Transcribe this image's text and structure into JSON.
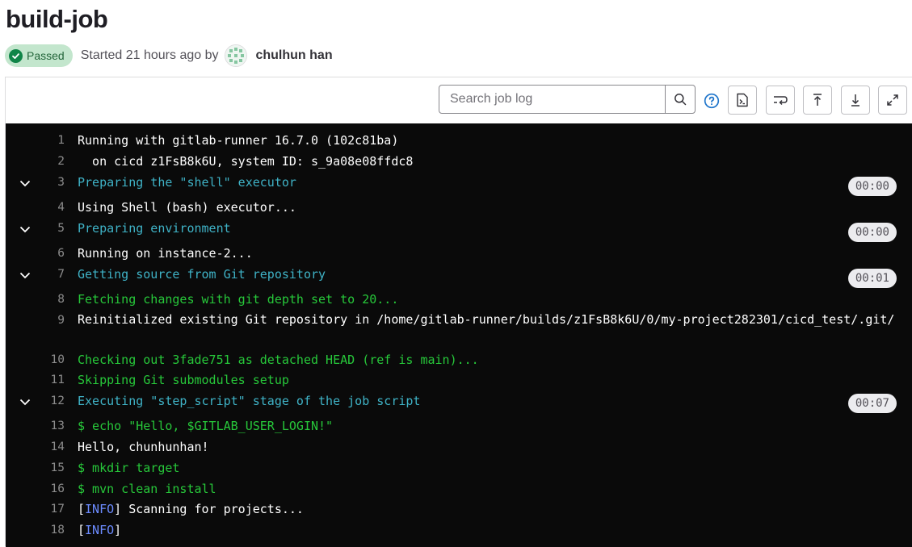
{
  "job": {
    "title": "build-job",
    "status": "Passed",
    "started": "Started 21 hours ago by",
    "user": "chulhun han"
  },
  "toolbar": {
    "search_placeholder": "Search job log"
  },
  "log": {
    "l1": {
      "n": "1",
      "t": "Running with gitlab-runner 16.7.0 (102c81ba)"
    },
    "l2": {
      "n": "2",
      "t": "  on cicd z1FsB8k6U, system ID: s_9a08e08ffdc8"
    },
    "l3": {
      "n": "3",
      "t": "Preparing the \"shell\" executor",
      "d": "00:00"
    },
    "l4": {
      "n": "4",
      "t": "Using Shell (bash) executor..."
    },
    "l5": {
      "n": "5",
      "t": "Preparing environment",
      "d": "00:00"
    },
    "l6": {
      "n": "6",
      "t": "Running on instance-2..."
    },
    "l7": {
      "n": "7",
      "t": "Getting source from Git repository",
      "d": "00:01"
    },
    "l8": {
      "n": "8",
      "t": "Fetching changes with git depth set to 20..."
    },
    "l9": {
      "n": "9",
      "t": "Reinitialized existing Git repository in /home/gitlab-runner/builds/z1FsB8k6U/0/my-project282301/cicd_test/.git/"
    },
    "l10": {
      "n": "10",
      "t": "Checking out 3fade751 as detached HEAD (ref is main)..."
    },
    "l11": {
      "n": "11",
      "t": "Skipping Git submodules setup"
    },
    "l12": {
      "n": "12",
      "t": "Executing \"step_script\" stage of the job script",
      "d": "00:07"
    },
    "l13": {
      "n": "13",
      "t": "$ echo \"Hello, $GITLAB_USER_LOGIN!\""
    },
    "l14": {
      "n": "14",
      "t": "Hello, chunhunhan!"
    },
    "l15": {
      "n": "15",
      "t": "$ mkdir target"
    },
    "l16": {
      "n": "16",
      "t": "$ mvn clean install"
    },
    "l17": {
      "n": "17",
      "open": "[",
      "tag": "INFO",
      "close": "]",
      "t": " Scanning for projects..."
    },
    "l18": {
      "n": "18",
      "open": "[",
      "tag": "INFO",
      "close": "]"
    }
  }
}
